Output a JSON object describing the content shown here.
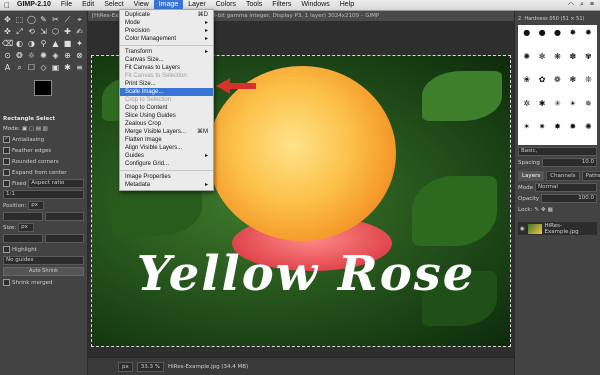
{
  "menubar": {
    "items": [
      "GIMP-2.10",
      "File",
      "Edit",
      "Select",
      "View",
      "Image",
      "Layer",
      "Colors",
      "Tools",
      "Filters",
      "Windows",
      "Help"
    ],
    "active": "Image"
  },
  "window": {
    "title": "[HiRes-Example] (imported)-4.0 (RGB color 8-bit gamma integer, Display P3, 1 layer) 3024x2109 – GIMP"
  },
  "image_menu": [
    {
      "label": "Duplicate",
      "shortcut": "⌘D",
      "type": "item"
    },
    {
      "label": "Mode",
      "shortcut": "▸",
      "type": "item"
    },
    {
      "label": "Precision",
      "shortcut": "▸",
      "type": "item"
    },
    {
      "label": "Color Management",
      "shortcut": "▸",
      "type": "item"
    },
    {
      "type": "sep"
    },
    {
      "label": "Transform",
      "shortcut": "▸",
      "type": "item"
    },
    {
      "label": "Canvas Size...",
      "shortcut": "",
      "type": "item"
    },
    {
      "label": "Fit Canvas to Layers",
      "shortcut": "",
      "type": "item"
    },
    {
      "label": "Fit Canvas to Selection",
      "shortcut": "",
      "type": "disabled"
    },
    {
      "label": "Print Size...",
      "shortcut": "",
      "type": "item"
    },
    {
      "label": "Scale Image...",
      "shortcut": "",
      "type": "highlight"
    },
    {
      "label": "Crop to Selection",
      "shortcut": "",
      "type": "disabled"
    },
    {
      "label": "Crop to Content",
      "shortcut": "",
      "type": "item"
    },
    {
      "label": "Slice Using Guides",
      "shortcut": "",
      "type": "item"
    },
    {
      "label": "Zealous Crop",
      "shortcut": "",
      "type": "item"
    },
    {
      "label": "Merge Visible Layers...",
      "shortcut": "⌘M",
      "type": "item"
    },
    {
      "label": "Flatten Image",
      "shortcut": "",
      "type": "item"
    },
    {
      "label": "Align Visible Layers...",
      "shortcut": "",
      "type": "item"
    },
    {
      "label": "Guides",
      "shortcut": "▸",
      "type": "item"
    },
    {
      "label": "Configure Grid...",
      "shortcut": "",
      "type": "item"
    },
    {
      "type": "sep"
    },
    {
      "label": "Image Properties",
      "shortcut": "",
      "type": "item"
    },
    {
      "label": "Metadata",
      "shortcut": "▸",
      "type": "item"
    }
  ],
  "toolbox": {
    "tool_icons": [
      "✥",
      "⬚",
      "◯",
      "✎",
      "✂",
      "⟋",
      "⌖",
      "✜",
      "⤢",
      "⟲",
      "⇲",
      "⬡",
      "✚",
      "✍",
      "⌫",
      "◐",
      "◑",
      "⚲",
      "▲",
      "■",
      "✦",
      "⊙",
      "❂",
      "☼",
      "✺",
      "◈",
      "⊕",
      "⊗",
      "A",
      "⌕",
      "☐",
      "◇",
      "▣",
      "✱",
      "≡"
    ],
    "options_title": "Rectangle Select",
    "mode_label": "Mode:",
    "antialiasing": "Antialiasing",
    "feather": "Feather edges",
    "rounded": "Rounded corners",
    "expand": "Expand from center",
    "fixed_label": "Fixed",
    "fixed_value": "Aspect ratio",
    "ratio_value": "1:1",
    "position_label": "Position:",
    "position_unit": "px",
    "size_label": "Size:",
    "size_unit": "px",
    "highlight": "Highlight",
    "guides": "No guides",
    "auto_shrink": "Auto Shrink",
    "shrink_merged": "Shrink merged"
  },
  "canvas": {
    "overlay_text": "Yellow Rose"
  },
  "status": {
    "unit": "px",
    "zoom": "33.3 %",
    "file": "HiRes-Example.jpg (34.4 MB)"
  },
  "dock": {
    "brush_name": "2. Hardness 050 (51 × 51)",
    "brush_glyphs": [
      "●",
      "●",
      "●",
      "✸",
      "✹",
      "✺",
      "✻",
      "❋",
      "✽",
      "✾",
      "❀",
      "✿",
      "❁",
      "❃",
      "❊",
      "✲",
      "✱",
      "✳",
      "✴",
      "✵",
      "✶",
      "✷",
      "✸",
      "✹",
      "✺"
    ],
    "tag": "Basic,",
    "spacing_label": "Spacing",
    "spacing_value": "10.0",
    "tabs": [
      "Layers",
      "Channels",
      "Paths"
    ],
    "mode_label": "Mode",
    "mode_value": "Normal",
    "opacity_label": "Opacity",
    "opacity_value": "100.0",
    "lock_label": "Lock:",
    "layer_name": "HiRes-Example.jpg"
  },
  "colors": {
    "accent": "#3875d7",
    "arrow": "#d8302b",
    "foreground": "#000000",
    "background": "#ffffff"
  }
}
